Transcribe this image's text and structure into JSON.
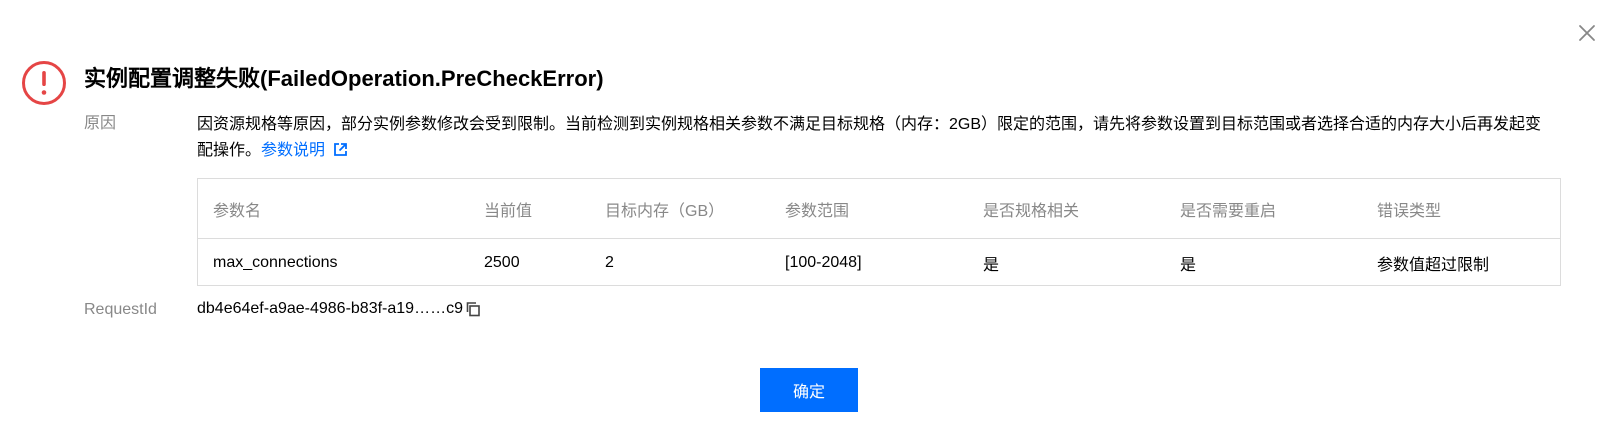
{
  "dialog": {
    "title": "实例配置调整失败(FailedOperation.PreCheckError)",
    "close_icon": "close-icon",
    "status_icon": "error-circle-icon",
    "accent_color": "#006eff",
    "error_color": "#e54545"
  },
  "reason": {
    "label": "原因",
    "text": "因资源规格等原因，部分实例参数修改会受到限制。当前检测到实例规格相关参数不满足目标规格（内存：2GB）限定的范围，请先将参数设置到目标范围或者选择合适的内存大小后再发起变配操作。",
    "link_text": "参数说明",
    "link_icon": "external-link-icon"
  },
  "table": {
    "headers": [
      "参数名",
      "当前值",
      "目标内存（GB）",
      "参数范围",
      "是否规格相关",
      "是否需要重启",
      "错误类型"
    ],
    "rows": [
      [
        "max_connections",
        "2500",
        "2",
        "[100-2048]",
        "是",
        "是",
        "参数值超过限制"
      ]
    ]
  },
  "request": {
    "label": "RequestId",
    "value": "db4e64ef-a9ae-4986-b83f-a19……c9",
    "copy_icon": "copy-icon"
  },
  "footer": {
    "confirm_label": "确定"
  }
}
